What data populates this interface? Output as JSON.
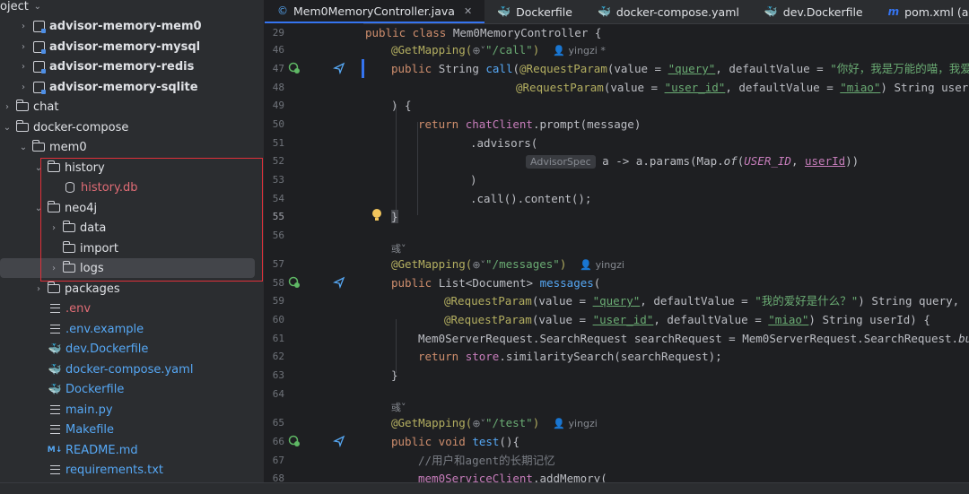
{
  "sidebar": {
    "header": "oject",
    "items": [
      {
        "label": "advisor-memory-mem0",
        "type": "module",
        "bold": true
      },
      {
        "label": "advisor-memory-mysql",
        "type": "module",
        "bold": true
      },
      {
        "label": "advisor-memory-redis",
        "type": "module",
        "bold": true
      },
      {
        "label": "advisor-memory-sqlite",
        "type": "module",
        "bold": true
      },
      {
        "label": "chat",
        "type": "folder"
      },
      {
        "label": "docker-compose",
        "type": "folder"
      },
      {
        "label": "mem0",
        "type": "folder"
      },
      {
        "label": "history",
        "type": "folder"
      },
      {
        "label": "history.db",
        "type": "db"
      },
      {
        "label": "neo4j",
        "type": "folder"
      },
      {
        "label": "data",
        "type": "folder"
      },
      {
        "label": "import",
        "type": "folder"
      },
      {
        "label": "logs",
        "type": "folder"
      },
      {
        "label": "packages",
        "type": "folder"
      },
      {
        "label": ".env",
        "type": "file"
      },
      {
        "label": ".env.example",
        "type": "file"
      },
      {
        "label": "dev.Dockerfile",
        "type": "docker"
      },
      {
        "label": "docker-compose.yaml",
        "type": "docker"
      },
      {
        "label": "Dockerfile",
        "type": "docker"
      },
      {
        "label": "main.py",
        "type": "file"
      },
      {
        "label": "Makefile",
        "type": "file"
      },
      {
        "label": "README.md",
        "type": "md",
        "icon_text": "M↓"
      },
      {
        "label": "requirements.txt",
        "type": "file"
      }
    ]
  },
  "tabs": [
    {
      "label": "Mem0MemoryController.java",
      "active": true,
      "icon": "java-class-icon"
    },
    {
      "label": "Dockerfile",
      "icon": "docker-icon"
    },
    {
      "label": "docker-compose.yaml",
      "icon": "docker-icon"
    },
    {
      "label": "dev.Dockerfile",
      "icon": "docker-icon"
    },
    {
      "label": "pom.xml (advis",
      "icon": "maven-icon",
      "icon_text": "m"
    }
  ],
  "editor": {
    "line_numbers": [
      "29",
      "46",
      "47",
      "48",
      "49",
      "50",
      "51",
      "52",
      "53",
      "54",
      "55",
      "56",
      "",
      "57",
      "58",
      "59",
      "60",
      "61",
      "62",
      "63",
      "64",
      "",
      "65",
      "66",
      "67",
      "68"
    ],
    "code": {
      "l29": {
        "a": "public class ",
        "b": "Mem0MemoryController {"
      },
      "l46": {
        "ann": "@GetMapping(",
        "glob": "⊕˅",
        "str": "\"/call\"",
        "close": ")",
        "author": "yingzi *"
      },
      "l47": {
        "kw": "public ",
        "t1": "String ",
        "fn": "call",
        "t2": "(",
        "ann": "@RequestParam",
        "t3": "(value = ",
        "s1": "\"query\"",
        "t4": ", defaultValue = ",
        "s2": "\"你好，我是万能的喵，我爱玩"
      },
      "l48": {
        "ann": "@RequestParam",
        "t1": "(value = ",
        "s1": "\"user_id\"",
        "t2": ", defaultValue = ",
        "s2": "\"miao\"",
        "t3": ") String userId"
      },
      "l49": {
        "t": ") {"
      },
      "l50": {
        "kw": "return ",
        "f": "chatClient",
        "t": ".prompt(message)"
      },
      "l51": {
        "t": ".advisors("
      },
      "l52": {
        "hint": "AdvisorSpec",
        "t1": " a -> a.params(Map.",
        "it": "of",
        "t2": "(",
        "c": "USER_ID",
        "t3": ", ",
        "u": "userId",
        "t4": "))"
      },
      "l53": {
        "t": ")"
      },
      "l54": {
        "t": ".call().content();"
      },
      "l55": {
        "t": "}"
      },
      "lhint1": {
        "t": "彧˅"
      },
      "l57": {
        "ann": "@GetMapping(",
        "glob": "⊕˅",
        "str": "\"/messages\"",
        "close": ")",
        "author": "yingzi"
      },
      "l58": {
        "kw": "public ",
        "t1": "List<Document> ",
        "fn": "messages",
        "t2": "("
      },
      "l59": {
        "ann": "@RequestParam",
        "t1": "(value = ",
        "s1": "\"query\"",
        "t2": ", defaultValue = ",
        "s2": "\"我的爱好是什么？\"",
        "t3": ") String query,"
      },
      "l60": {
        "ann": "@RequestParam",
        "t1": "(value = ",
        "s1": "\"user_id\"",
        "t2": ", defaultValue = ",
        "s2": "\"miao\"",
        "t3": ") String userId) {"
      },
      "l61": {
        "t1": "Mem0ServerRequest.SearchRequest searchRequest = Mem0ServerRequest.SearchRequest.",
        "it": "buil"
      },
      "l62": {
        "kw": "return ",
        "f": "store",
        "t": ".similaritySearch(searchRequest);"
      },
      "l63": {
        "t": "}"
      },
      "lhint2": {
        "t": "彧˅"
      },
      "l65": {
        "ann": "@GetMapping(",
        "glob": "⊕˅",
        "str": "\"/test\"",
        "close": ")",
        "author": "yingzi"
      },
      "l66": {
        "kw": "public void ",
        "fn": "test",
        "t": "(){"
      },
      "l67": {
        "c": "//用户和agent的长期记忆"
      },
      "l68": {
        "f": "mem0ServiceClient",
        "t": ".addMemory("
      }
    }
  },
  "colors": {
    "highlight": "#e0303a",
    "accent": "#3574f0"
  }
}
